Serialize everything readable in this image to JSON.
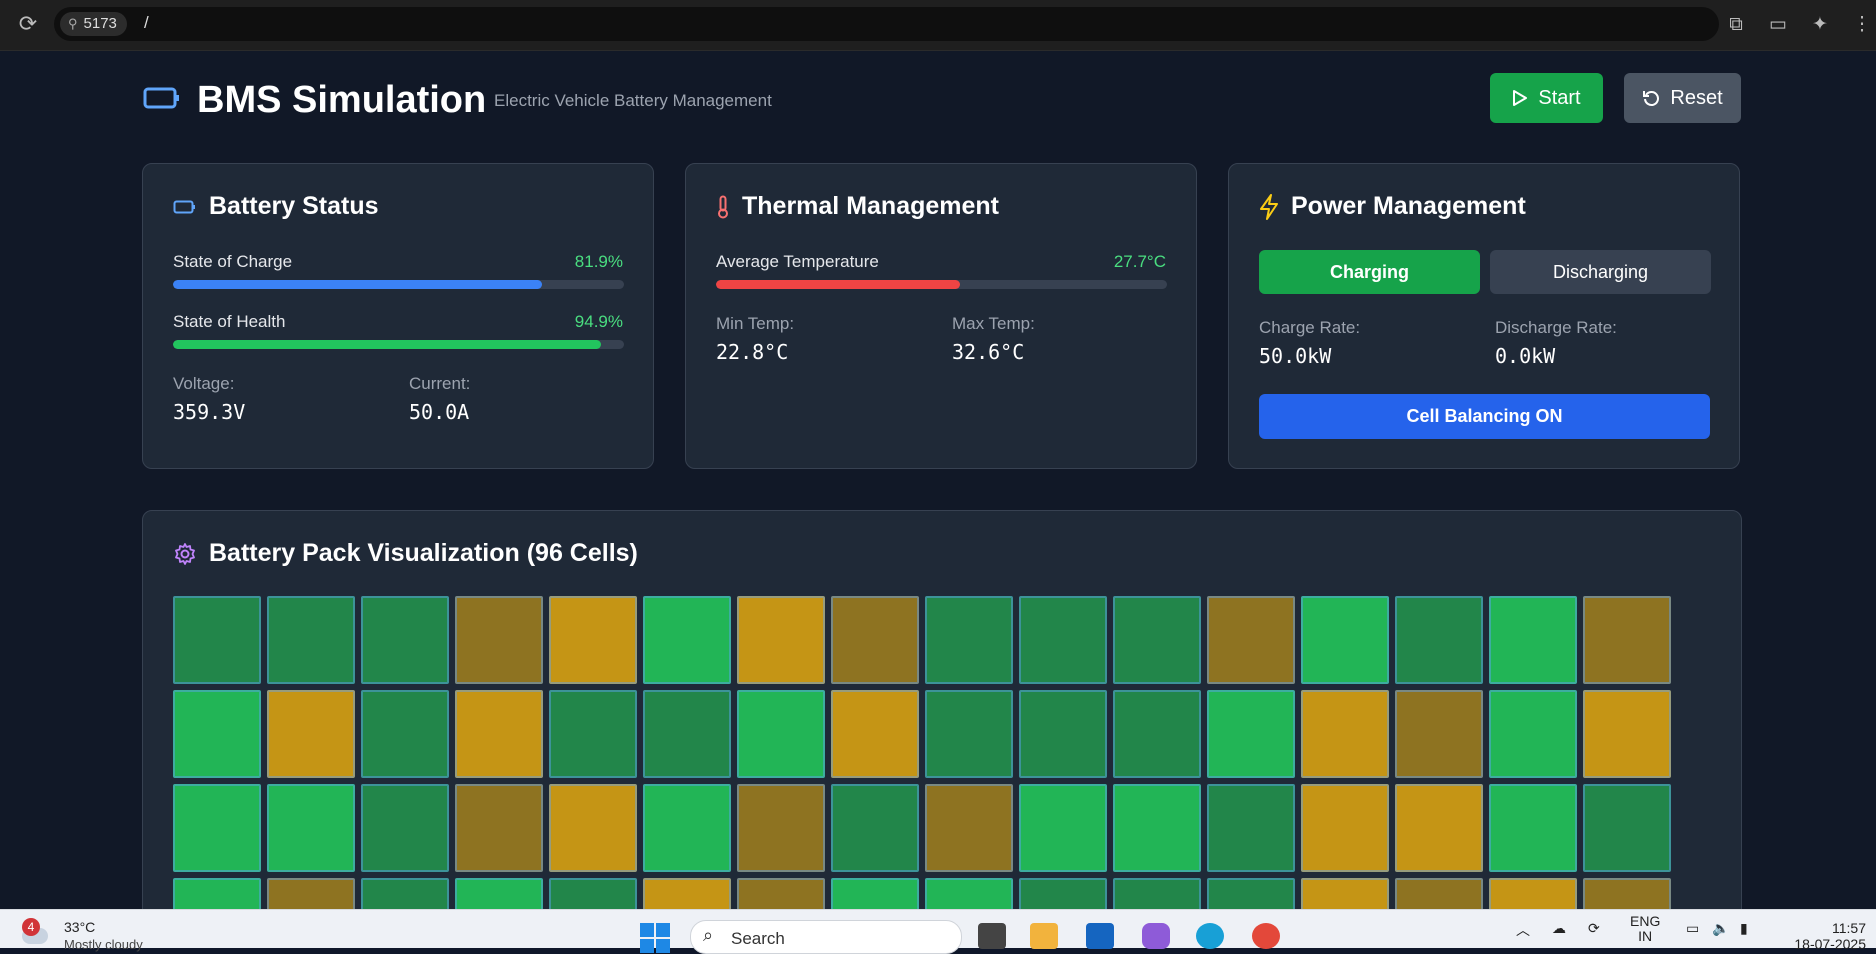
{
  "browser": {
    "port_chip": "5173",
    "path": "/"
  },
  "header": {
    "title": "BMS Simulation",
    "subtitle": "Electric Vehicle Battery Management",
    "start_label": "Start",
    "reset_label": "Reset"
  },
  "battery_status": {
    "title": "Battery Status",
    "soc_label": "State of Charge",
    "soc_value": "81.9%",
    "soc_fraction": 0.819,
    "soh_label": "State of Health",
    "soh_value": "94.9%",
    "soh_fraction": 0.949,
    "voltage_label": "Voltage:",
    "voltage_value": "359.3V",
    "current_label": "Current:",
    "current_value": "50.0A"
  },
  "thermal": {
    "title": "Thermal Management",
    "avg_label": "Average Temperature",
    "avg_value": "27.7°C",
    "avg_fraction": 0.54,
    "min_label": "Min Temp:",
    "min_value": "22.8°C",
    "max_label": "Max Temp:",
    "max_value": "32.6°C"
  },
  "power": {
    "title": "Power Management",
    "charging_label": "Charging",
    "discharging_label": "Discharging",
    "charge_rate_label": "Charge Rate:",
    "charge_rate_value": "50.0kW",
    "discharge_rate_label": "Discharge Rate:",
    "discharge_rate_value": "0.0kW",
    "balancing_label": "Cell Balancing ON"
  },
  "pack": {
    "title": "Battery Pack Visualization (96 Cells)",
    "cell_colors": {
      "D": "#22864a",
      "B": "#22b556",
      "Y": "#c59515",
      "O": "#8e7321"
    },
    "rows": [
      "DDDOYBYODDDOBDBO",
      "BYDYDDBYDDDBYOBY",
      "BBDOYBODOBBDYYBD",
      "BODBDYOBBDDDYOYO"
    ]
  },
  "taskbar": {
    "badge": "4",
    "temperature": "33°C",
    "weather": "Mostly cloudy",
    "search_placeholder": "Search",
    "lang": "ENG",
    "region": "IN",
    "time": "11:57",
    "date": "18-07-2025"
  },
  "colors": {
    "accent_blue": "#3b82f6",
    "green": "#16a34a",
    "red": "#ef4444",
    "bg": "#111827",
    "card": "#1f2937"
  }
}
